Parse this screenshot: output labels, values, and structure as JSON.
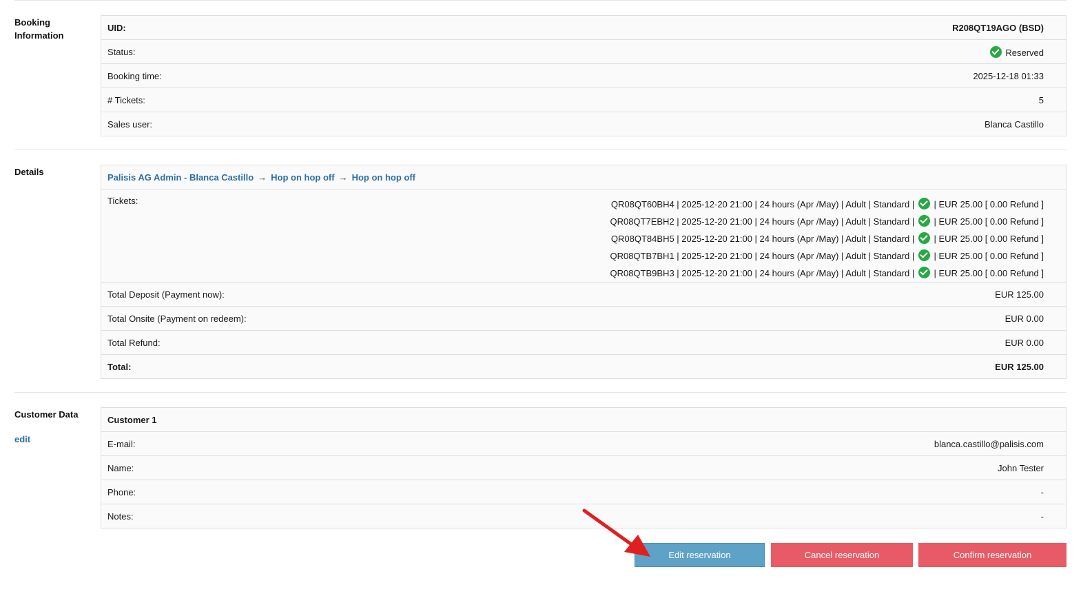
{
  "booking": {
    "section_label": "Booking Information",
    "rows": [
      {
        "key": "UID:",
        "value": "R208QT19AGO (BSD)"
      },
      {
        "key": "Status:",
        "value": "Reserved"
      },
      {
        "key": "Booking time:",
        "value": "2025-12-18 01:33"
      },
      {
        "key": "# Tickets:",
        "value": "5"
      },
      {
        "key": "Sales user:",
        "value": "Blanca Castillo"
      }
    ]
  },
  "details": {
    "section_label": "Details",
    "breadcrumb": [
      "Palisis AG Admin - Blanca Castillo",
      "Hop on hop off",
      "Hop on hop off"
    ],
    "tickets_label": "Tickets:",
    "tickets": [
      {
        "pre": "QR08QT60BH4 | 2025-12-20 21:00 | 24 hours (Apr /May) | Adult | Standard |",
        "post": "| EUR 25.00 [ 0.00 Refund ]"
      },
      {
        "pre": "QR08QT7EBH2 | 2025-12-20 21:00 | 24 hours (Apr /May) | Adult | Standard |",
        "post": "| EUR 25.00 [ 0.00 Refund ]"
      },
      {
        "pre": "QR08QT84BH5 | 2025-12-20 21:00 | 24 hours (Apr /May) | Adult | Standard |",
        "post": "| EUR 25.00 [ 0.00 Refund ]"
      },
      {
        "pre": "QR08QTB7BH1 | 2025-12-20 21:00 | 24 hours (Apr /May) | Adult | Standard |",
        "post": "| EUR 25.00 [ 0.00 Refund ]"
      },
      {
        "pre": "QR08QTB9BH3 | 2025-12-20 21:00 | 24 hours (Apr /May) | Adult | Standard |",
        "post": "| EUR 25.00 [ 0.00 Refund ]"
      }
    ],
    "totals": [
      {
        "key": "Total Deposit (Payment now):",
        "value": "EUR 125.00"
      },
      {
        "key": "Total Onsite (Payment on redeem):",
        "value": "EUR 0.00"
      },
      {
        "key": "Total Refund:",
        "value": "EUR 0.00"
      },
      {
        "key": "Total:",
        "value": "EUR 125.00"
      }
    ]
  },
  "customer": {
    "section_label": "Customer Data",
    "edit_label": "edit",
    "heading": "Customer 1",
    "rows": [
      {
        "key": "E-mail:",
        "value": "blanca.castillo@palisis.com"
      },
      {
        "key": "Name:",
        "value": "John Tester"
      },
      {
        "key": "Phone:",
        "value": "-"
      },
      {
        "key": "Notes:",
        "value": "-"
      }
    ]
  },
  "actions": {
    "edit_label": "Edit reservation",
    "cancel_label": "Cancel reservation",
    "confirm_label": "Confirm reservation"
  },
  "colors": {
    "accent_link": "#2a6fa8",
    "edit_button": "#5ea2c7",
    "danger_button": "#e85a66",
    "success": "#27a844",
    "annotation_arrow": "#e02020"
  },
  "icons": {
    "status": "check-circle-icon",
    "breadcrumb_separator": "arrow-right-icon"
  }
}
